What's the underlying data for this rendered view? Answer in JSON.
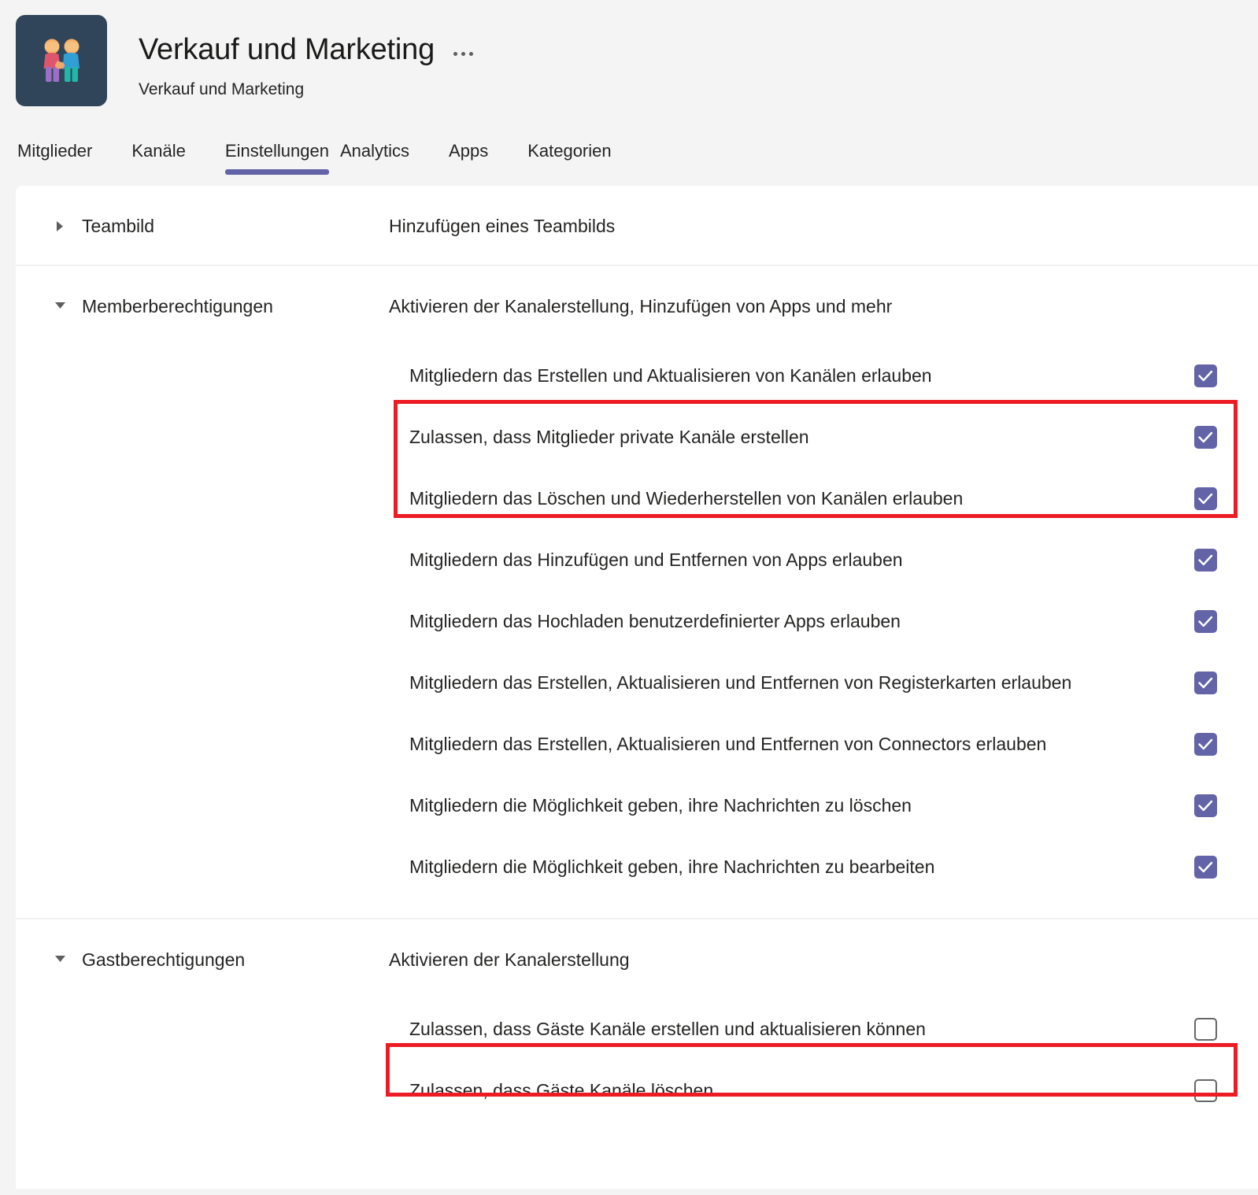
{
  "header": {
    "avatar_icon": "handshake-people-icon",
    "title": "Verkauf und Marketing",
    "subtitle": "Verkauf und Marketing",
    "overflow_icon": "more-options-icon"
  },
  "tabs": [
    {
      "label": "Mitglieder",
      "active": false
    },
    {
      "label": "Kanäle",
      "active": false
    },
    {
      "label": "Einstellungen",
      "active": true
    },
    {
      "label": "Analytics",
      "active": false
    },
    {
      "label": "Apps",
      "active": false
    },
    {
      "label": "Kategorien",
      "active": false
    }
  ],
  "sections": [
    {
      "name": "Teambild",
      "description": "Hinzufügen eines Teambilds",
      "expanded": false,
      "twisty_icon": "chevron-right-icon",
      "options": []
    },
    {
      "name": "Memberberechtigungen",
      "description": "Aktivieren der Kanalerstellung, Hinzufügen von Apps und mehr",
      "expanded": true,
      "twisty_icon": "chevron-down-icon",
      "options": [
        {
          "label": "Mitgliedern das Erstellen und Aktualisieren von Kanälen erlauben",
          "checked": true
        },
        {
          "label": "Zulassen, dass Mitglieder private Kanäle erstellen",
          "checked": true
        },
        {
          "label": "Mitgliedern das Löschen und Wiederherstellen von Kanälen erlauben",
          "checked": true
        },
        {
          "label": "Mitgliedern das Hinzufügen und Entfernen von Apps erlauben",
          "checked": true
        },
        {
          "label": "Mitgliedern das Hochladen benutzerdefinierter Apps erlauben",
          "checked": true
        },
        {
          "label": "Mitgliedern das Erstellen, Aktualisieren und Entfernen von Registerkarten erlauben",
          "checked": true
        },
        {
          "label": "Mitgliedern das Erstellen, Aktualisieren und Entfernen von Connectors erlauben",
          "checked": true
        },
        {
          "label": "Mitgliedern die Möglichkeit geben, ihre Nachrichten zu löschen",
          "checked": true
        },
        {
          "label": "Mitgliedern die Möglichkeit geben, ihre Nachrichten zu bearbeiten",
          "checked": true
        }
      ]
    },
    {
      "name": "Gastberechtigungen",
      "description": "Aktivieren der Kanalerstellung",
      "expanded": true,
      "twisty_icon": "chevron-down-icon",
      "options": [
        {
          "label": "Zulassen, dass Gäste Kanäle erstellen und aktualisieren können",
          "checked": false
        },
        {
          "label": "Zulassen, dass Gäste Kanäle löschen",
          "checked": false
        }
      ]
    }
  ],
  "annotations": {
    "member_highlight_label": "red-highlight-member-channel-permissions",
    "guest_highlight_label": "red-highlight-guest-channel-permission",
    "color": "#ed1c24"
  },
  "colors": {
    "accent": "#6264a7",
    "page_background": "#f4f4f4",
    "sheet_background": "#ffffff",
    "text": "#252423",
    "avatar_background": "#31455a",
    "annotation_red": "#ed1c24",
    "unchecked_border": "#666666"
  }
}
